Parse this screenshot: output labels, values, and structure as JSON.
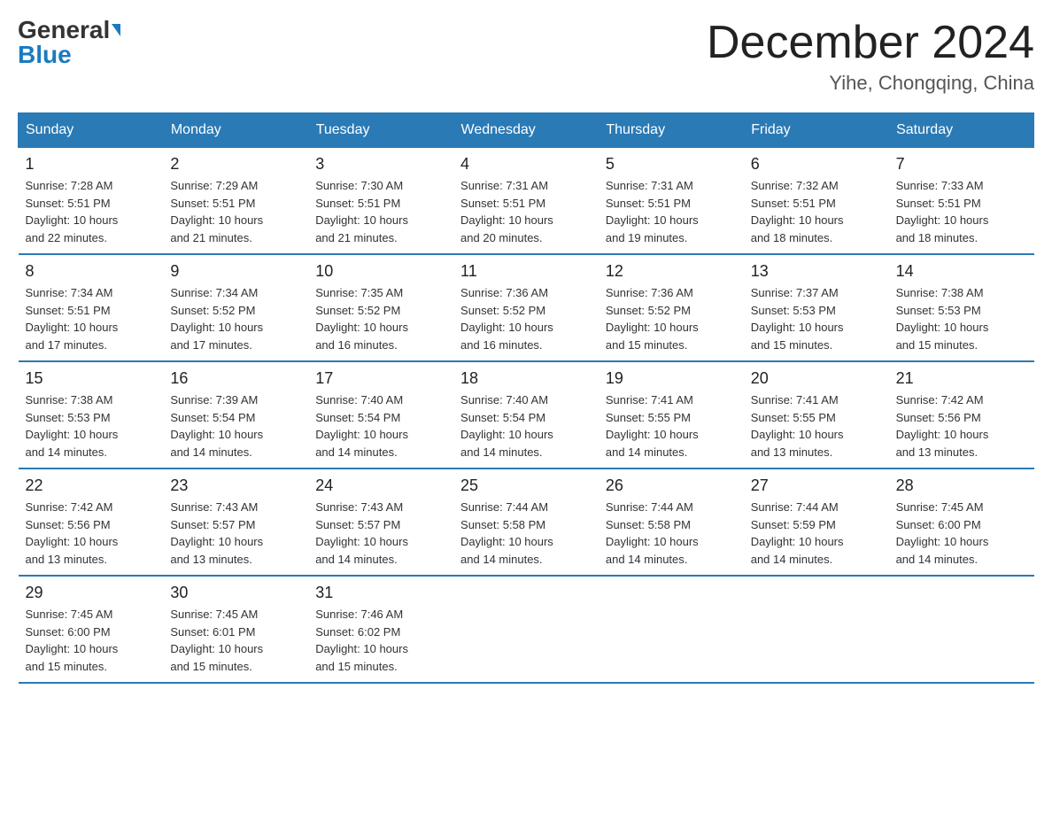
{
  "logo": {
    "general": "General",
    "blue": "Blue",
    "triangle": "▶"
  },
  "title": "December 2024",
  "subtitle": "Yihe, Chongqing, China",
  "days_header": [
    "Sunday",
    "Monday",
    "Tuesday",
    "Wednesday",
    "Thursday",
    "Friday",
    "Saturday"
  ],
  "weeks": [
    [
      {
        "day": "1",
        "sunrise": "7:28 AM",
        "sunset": "5:51 PM",
        "daylight": "10 hours and 22 minutes."
      },
      {
        "day": "2",
        "sunrise": "7:29 AM",
        "sunset": "5:51 PM",
        "daylight": "10 hours and 21 minutes."
      },
      {
        "day": "3",
        "sunrise": "7:30 AM",
        "sunset": "5:51 PM",
        "daylight": "10 hours and 21 minutes."
      },
      {
        "day": "4",
        "sunrise": "7:31 AM",
        "sunset": "5:51 PM",
        "daylight": "10 hours and 20 minutes."
      },
      {
        "day": "5",
        "sunrise": "7:31 AM",
        "sunset": "5:51 PM",
        "daylight": "10 hours and 19 minutes."
      },
      {
        "day": "6",
        "sunrise": "7:32 AM",
        "sunset": "5:51 PM",
        "daylight": "10 hours and 18 minutes."
      },
      {
        "day": "7",
        "sunrise": "7:33 AM",
        "sunset": "5:51 PM",
        "daylight": "10 hours and 18 minutes."
      }
    ],
    [
      {
        "day": "8",
        "sunrise": "7:34 AM",
        "sunset": "5:51 PM",
        "daylight": "10 hours and 17 minutes."
      },
      {
        "day": "9",
        "sunrise": "7:34 AM",
        "sunset": "5:52 PM",
        "daylight": "10 hours and 17 minutes."
      },
      {
        "day": "10",
        "sunrise": "7:35 AM",
        "sunset": "5:52 PM",
        "daylight": "10 hours and 16 minutes."
      },
      {
        "day": "11",
        "sunrise": "7:36 AM",
        "sunset": "5:52 PM",
        "daylight": "10 hours and 16 minutes."
      },
      {
        "day": "12",
        "sunrise": "7:36 AM",
        "sunset": "5:52 PM",
        "daylight": "10 hours and 15 minutes."
      },
      {
        "day": "13",
        "sunrise": "7:37 AM",
        "sunset": "5:53 PM",
        "daylight": "10 hours and 15 minutes."
      },
      {
        "day": "14",
        "sunrise": "7:38 AM",
        "sunset": "5:53 PM",
        "daylight": "10 hours and 15 minutes."
      }
    ],
    [
      {
        "day": "15",
        "sunrise": "7:38 AM",
        "sunset": "5:53 PM",
        "daylight": "10 hours and 14 minutes."
      },
      {
        "day": "16",
        "sunrise": "7:39 AM",
        "sunset": "5:54 PM",
        "daylight": "10 hours and 14 minutes."
      },
      {
        "day": "17",
        "sunrise": "7:40 AM",
        "sunset": "5:54 PM",
        "daylight": "10 hours and 14 minutes."
      },
      {
        "day": "18",
        "sunrise": "7:40 AM",
        "sunset": "5:54 PM",
        "daylight": "10 hours and 14 minutes."
      },
      {
        "day": "19",
        "sunrise": "7:41 AM",
        "sunset": "5:55 PM",
        "daylight": "10 hours and 14 minutes."
      },
      {
        "day": "20",
        "sunrise": "7:41 AM",
        "sunset": "5:55 PM",
        "daylight": "10 hours and 13 minutes."
      },
      {
        "day": "21",
        "sunrise": "7:42 AM",
        "sunset": "5:56 PM",
        "daylight": "10 hours and 13 minutes."
      }
    ],
    [
      {
        "day": "22",
        "sunrise": "7:42 AM",
        "sunset": "5:56 PM",
        "daylight": "10 hours and 13 minutes."
      },
      {
        "day": "23",
        "sunrise": "7:43 AM",
        "sunset": "5:57 PM",
        "daylight": "10 hours and 13 minutes."
      },
      {
        "day": "24",
        "sunrise": "7:43 AM",
        "sunset": "5:57 PM",
        "daylight": "10 hours and 14 minutes."
      },
      {
        "day": "25",
        "sunrise": "7:44 AM",
        "sunset": "5:58 PM",
        "daylight": "10 hours and 14 minutes."
      },
      {
        "day": "26",
        "sunrise": "7:44 AM",
        "sunset": "5:58 PM",
        "daylight": "10 hours and 14 minutes."
      },
      {
        "day": "27",
        "sunrise": "7:44 AM",
        "sunset": "5:59 PM",
        "daylight": "10 hours and 14 minutes."
      },
      {
        "day": "28",
        "sunrise": "7:45 AM",
        "sunset": "6:00 PM",
        "daylight": "10 hours and 14 minutes."
      }
    ],
    [
      {
        "day": "29",
        "sunrise": "7:45 AM",
        "sunset": "6:00 PM",
        "daylight": "10 hours and 15 minutes."
      },
      {
        "day": "30",
        "sunrise": "7:45 AM",
        "sunset": "6:01 PM",
        "daylight": "10 hours and 15 minutes."
      },
      {
        "day": "31",
        "sunrise": "7:46 AM",
        "sunset": "6:02 PM",
        "daylight": "10 hours and 15 minutes."
      },
      null,
      null,
      null,
      null
    ]
  ],
  "labels": {
    "sunrise": "Sunrise: ",
    "sunset": "Sunset: ",
    "daylight": "Daylight: "
  }
}
